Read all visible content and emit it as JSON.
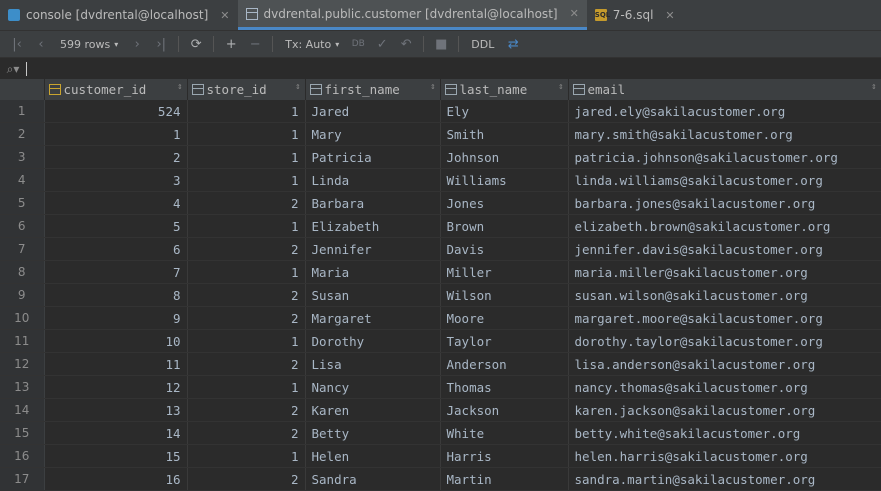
{
  "tabs": [
    {
      "label": "console [dvdrental@localhost]",
      "icon": "console-icon",
      "active": false
    },
    {
      "label": "dvdrental.public.customer [dvdrental@localhost]",
      "icon": "table-icon",
      "active": true
    },
    {
      "label": "7-6.sql",
      "icon": "sql-file-icon",
      "active": false
    }
  ],
  "toolbar": {
    "rows_label": "599 rows",
    "tx_label": "Tx: Auto",
    "ddl_label": "DDL"
  },
  "filter": {
    "value": ""
  },
  "columns": [
    {
      "label": "customer_id",
      "icon": "key-column-icon"
    },
    {
      "label": "store_id",
      "icon": "column-icon"
    },
    {
      "label": "first_name",
      "icon": "column-icon"
    },
    {
      "label": "last_name",
      "icon": "column-icon"
    },
    {
      "label": "email",
      "icon": "column-icon"
    }
  ],
  "rows": [
    {
      "n": "1",
      "customer_id": "524",
      "store_id": "1",
      "first_name": "Jared",
      "last_name": "Ely",
      "email": "jared.ely@sakilacustomer.org"
    },
    {
      "n": "2",
      "customer_id": "1",
      "store_id": "1",
      "first_name": "Mary",
      "last_name": "Smith",
      "email": "mary.smith@sakilacustomer.org"
    },
    {
      "n": "3",
      "customer_id": "2",
      "store_id": "1",
      "first_name": "Patricia",
      "last_name": "Johnson",
      "email": "patricia.johnson@sakilacustomer.org"
    },
    {
      "n": "4",
      "customer_id": "3",
      "store_id": "1",
      "first_name": "Linda",
      "last_name": "Williams",
      "email": "linda.williams@sakilacustomer.org"
    },
    {
      "n": "5",
      "customer_id": "4",
      "store_id": "2",
      "first_name": "Barbara",
      "last_name": "Jones",
      "email": "barbara.jones@sakilacustomer.org"
    },
    {
      "n": "6",
      "customer_id": "5",
      "store_id": "1",
      "first_name": "Elizabeth",
      "last_name": "Brown",
      "email": "elizabeth.brown@sakilacustomer.org"
    },
    {
      "n": "7",
      "customer_id": "6",
      "store_id": "2",
      "first_name": "Jennifer",
      "last_name": "Davis",
      "email": "jennifer.davis@sakilacustomer.org"
    },
    {
      "n": "8",
      "customer_id": "7",
      "store_id": "1",
      "first_name": "Maria",
      "last_name": "Miller",
      "email": "maria.miller@sakilacustomer.org"
    },
    {
      "n": "9",
      "customer_id": "8",
      "store_id": "2",
      "first_name": "Susan",
      "last_name": "Wilson",
      "email": "susan.wilson@sakilacustomer.org"
    },
    {
      "n": "10",
      "customer_id": "9",
      "store_id": "2",
      "first_name": "Margaret",
      "last_name": "Moore",
      "email": "margaret.moore@sakilacustomer.org"
    },
    {
      "n": "11",
      "customer_id": "10",
      "store_id": "1",
      "first_name": "Dorothy",
      "last_name": "Taylor",
      "email": "dorothy.taylor@sakilacustomer.org"
    },
    {
      "n": "12",
      "customer_id": "11",
      "store_id": "2",
      "first_name": "Lisa",
      "last_name": "Anderson",
      "email": "lisa.anderson@sakilacustomer.org"
    },
    {
      "n": "13",
      "customer_id": "12",
      "store_id": "1",
      "first_name": "Nancy",
      "last_name": "Thomas",
      "email": "nancy.thomas@sakilacustomer.org"
    },
    {
      "n": "14",
      "customer_id": "13",
      "store_id": "2",
      "first_name": "Karen",
      "last_name": "Jackson",
      "email": "karen.jackson@sakilacustomer.org"
    },
    {
      "n": "15",
      "customer_id": "14",
      "store_id": "2",
      "first_name": "Betty",
      "last_name": "White",
      "email": "betty.white@sakilacustomer.org"
    },
    {
      "n": "16",
      "customer_id": "15",
      "store_id": "1",
      "first_name": "Helen",
      "last_name": "Harris",
      "email": "helen.harris@sakilacustomer.org"
    },
    {
      "n": "17",
      "customer_id": "16",
      "store_id": "2",
      "first_name": "Sandra",
      "last_name": "Martin",
      "email": "sandra.martin@sakilacustomer.org"
    }
  ],
  "colors": {
    "accent": "#4a88c7",
    "background": "#2b2b2b",
    "header": "#3c3f41"
  }
}
